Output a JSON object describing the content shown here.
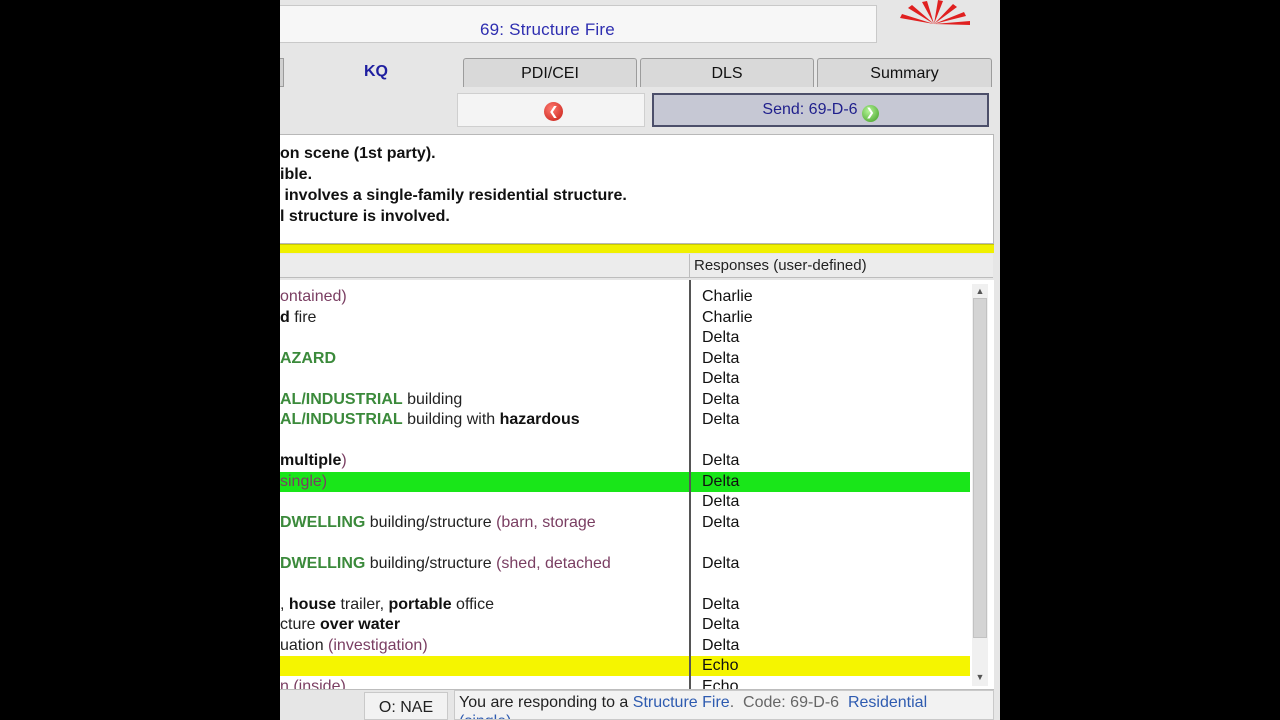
{
  "header": {
    "title": "69:  Structure Fire"
  },
  "tabs": [
    {
      "label": "KQ",
      "active": true
    },
    {
      "label": "PDI/CEI",
      "active": false
    },
    {
      "label": "DLS",
      "active": false
    },
    {
      "label": "Summary",
      "active": false
    }
  ],
  "toolbar": {
    "send_label": "Send: 69-D-6"
  },
  "summary_lines": [
    "on scene (1st party).",
    "ible.",
    " involves a single-family residential structure.",
    "l structure is involved."
  ],
  "table": {
    "right_header": "Responses (user-defined)",
    "highlight_colors": {
      "selected": "#19e619",
      "warning": "#f5f500"
    },
    "rows": [
      {
        "left_html_parts": [
          {
            "t": "ontained)",
            "c": "p"
          }
        ],
        "response": "Charlie"
      },
      {
        "left_html_parts": [
          {
            "t": "d",
            "c": "b"
          },
          {
            "t": " fire",
            "c": ""
          }
        ],
        "response": "Charlie"
      },
      {
        "left_html_parts": [],
        "response": "Delta"
      },
      {
        "left_html_parts": [
          {
            "t": "AZARD",
            "c": "g"
          }
        ],
        "response": "Delta"
      },
      {
        "left_html_parts": [],
        "response": "Delta"
      },
      {
        "left_html_parts": [
          {
            "t": "AL/INDUSTRIAL",
            "c": "g"
          },
          {
            "t": " building",
            "c": ""
          }
        ],
        "response": "Delta"
      },
      {
        "left_html_parts": [
          {
            "t": "AL/INDUSTRIAL",
            "c": "g"
          },
          {
            "t": " building with ",
            "c": ""
          },
          {
            "t": "hazardous",
            "c": "b"
          }
        ],
        "response": "Delta"
      },
      {
        "left_html_parts": [],
        "response": ""
      },
      {
        "left_html_parts": [
          {
            "t": "multiple",
            "c": "b"
          },
          {
            "t": ")",
            "c": "p"
          }
        ],
        "response": "Delta"
      },
      {
        "left_html_parts": [
          {
            "t": "single)",
            "c": "p"
          }
        ],
        "response": "Delta",
        "highlight": "selected"
      },
      {
        "left_html_parts": [],
        "response": "Delta"
      },
      {
        "left_html_parts": [
          {
            "t": "DWELLING",
            "c": "g"
          },
          {
            "t": " building/structure ",
            "c": ""
          },
          {
            "t": "(barn, storage",
            "c": "p"
          }
        ],
        "response": "Delta"
      },
      {
        "left_html_parts": [],
        "response": ""
      },
      {
        "left_html_parts": [
          {
            "t": "DWELLING",
            "c": "g"
          },
          {
            "t": " building/structure ",
            "c": ""
          },
          {
            "t": "(shed, detached",
            "c": "p"
          }
        ],
        "response": "Delta"
      },
      {
        "left_html_parts": [],
        "response": ""
      },
      {
        "left_html_parts": [
          {
            "t": ", ",
            "c": ""
          },
          {
            "t": "house",
            "c": "b"
          },
          {
            "t": " trailer, ",
            "c": ""
          },
          {
            "t": "portable",
            "c": "b"
          },
          {
            "t": " office",
            "c": ""
          }
        ],
        "response": "Delta"
      },
      {
        "left_html_parts": [
          {
            "t": "cture ",
            "c": ""
          },
          {
            "t": "over water",
            "c": "b"
          }
        ],
        "response": "Delta"
      },
      {
        "left_html_parts": [
          {
            "t": "uation ",
            "c": ""
          },
          {
            "t": "(investigation)",
            "c": "p"
          }
        ],
        "response": "Delta"
      },
      {
        "left_html_parts": [],
        "response": "Echo",
        "highlight": "warning"
      },
      {
        "left_html_parts": [
          {
            "t": "n (inside)",
            "c": "p"
          }
        ],
        "response": "Echo"
      }
    ]
  },
  "status": {
    "left": "O: NAE",
    "right_parts": [
      {
        "t": "You are responding to a ",
        "c": ""
      },
      {
        "t": "Structure Fire",
        "c": "blue"
      },
      {
        "t": ".  Code: 69-D-6  ",
        "c": "gray"
      },
      {
        "t": "Residential",
        "c": "blue"
      }
    ],
    "right_line2": "(single)"
  }
}
